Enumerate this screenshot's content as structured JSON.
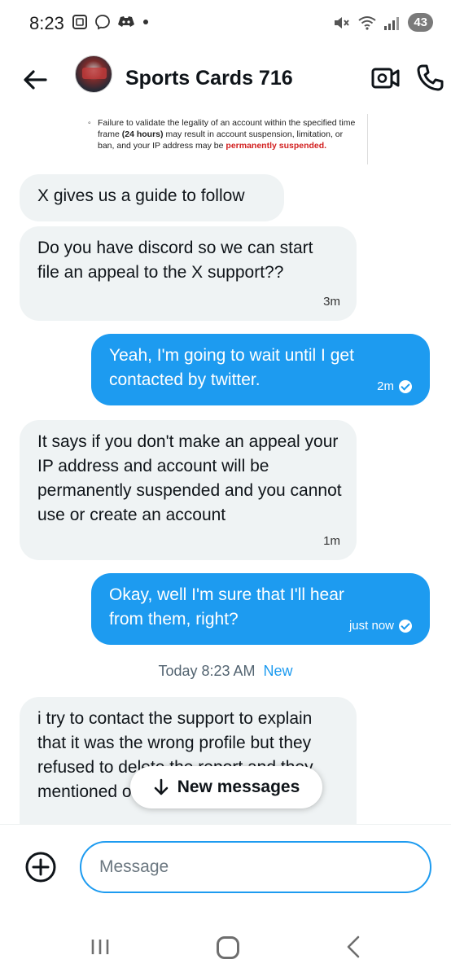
{
  "status_bar": {
    "time": "8:23",
    "battery": "43",
    "icons": [
      "screenshot-icon",
      "messenger-icon",
      "discord-icon",
      "dot-icon",
      "mute-icon",
      "wifi-icon",
      "signal-icon"
    ]
  },
  "header": {
    "name": "Sports Cards 716",
    "icons": [
      "back-arrow-icon",
      "video-call-icon",
      "phone-icon"
    ]
  },
  "document_snippet": {
    "line_pre": "Failure to validate the legality of an account within the specified time frame ",
    "bold": "(24 hours)",
    "line_post": " may result in account suspension, limitation, or ban, and your IP address may be ",
    "red": "permanently suspended."
  },
  "messages": [
    {
      "direction": "in",
      "text": "X gives us a guide to follow",
      "time": ""
    },
    {
      "direction": "in",
      "text": "Do you have discord so we can start file an appeal to the X support??",
      "time": "3m"
    },
    {
      "direction": "out",
      "text": "Yeah, I'm going to wait until I get contacted by twitter.",
      "time": "2m"
    },
    {
      "direction": "in",
      "text": "It says if you don't make an appeal your IP address and account will be permanently suspended and you cannot use or create an account",
      "time": "1m"
    },
    {
      "direction": "out",
      "text": "Okay, well I'm sure that I'll hear from them, right?",
      "time": "just now"
    },
    {
      "direction": "in",
      "text": "i try to contact the support to explain that it was the wrong profile but they refused to delete the report and they mentioned on email that they",
      "time": ""
    }
  ],
  "divider": {
    "time": "Today 8:23 AM",
    "new_label": "New"
  },
  "new_messages_pill": {
    "label": "New messages"
  },
  "composer": {
    "placeholder": "Message"
  },
  "colors": {
    "accent": "#1d9bf0",
    "incoming_bubble": "#eff3f4",
    "text": "#0f1419",
    "muted": "#536471"
  }
}
